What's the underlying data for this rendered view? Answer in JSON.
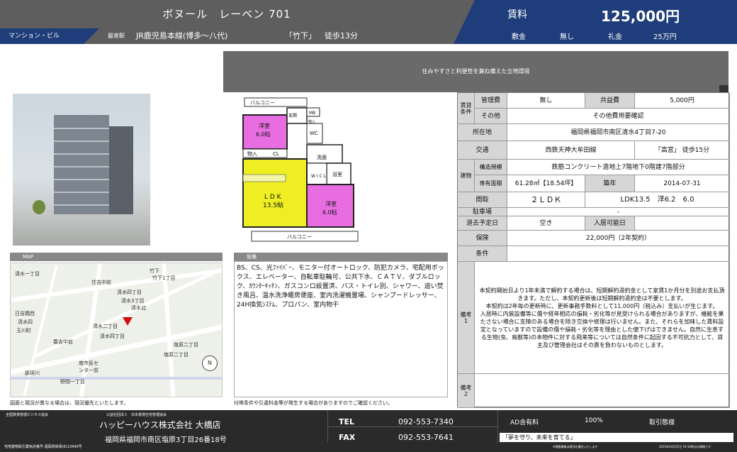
{
  "header": {
    "title": "ボヌール　レーベン 701",
    "category": "マンション・ビル",
    "station_label": "最寄駅",
    "line": "JR鹿児島本線(博多～八代)",
    "station": "「竹下」",
    "walk": "徒歩13分"
  },
  "price": {
    "rent_label": "賃料",
    "rent": "125,000円",
    "deposit_label": "敷金",
    "deposit": "無し",
    "key_label": "礼金",
    "key_money": "25万円"
  },
  "banner": "住みやすさと利便性を兼ね備えた立地環境",
  "floorplan": {
    "balcony_top": "バルコニー",
    "room1": "洋室",
    "room1_size": "6.0帖",
    "entrance": "玄関",
    "mb": "MB",
    "shoebox": "物入",
    "wc": "WC",
    "closet1": "物入",
    "cl": "CL",
    "washroom": "洗面",
    "bath": "浴室",
    "wcl": "W I C L",
    "ldk": "L D K",
    "ldk_size": "13.5帖",
    "room2": "洋室",
    "room2_size": "6.0帖",
    "balcony_bottom": "バルコニー"
  },
  "map": {
    "tab": "MAP",
    "labels": [
      "竹下",
      "清水一丁目",
      "竹下1丁目",
      "住吉中前",
      "清水四丁目",
      "清水3丁目",
      "清水北",
      "日吉橋西",
      "清水四",
      "玉川町",
      "清水二丁目",
      "春吉中前",
      "清水四丁目",
      "塩原二丁目",
      "塩原二丁目",
      "南市民セ",
      "ンター前",
      "那珂川",
      "野間一丁目"
    ],
    "compass": "N",
    "note": "図面と現況が異なる場合は、現況優先といたします。"
  },
  "equipment": {
    "tab": "設備",
    "text": "BS、CS、光ﾌｧｲﾊﾞｰ、モニター付オートロック、防犯カメラ、宅配用ボックス、エレベーター、自転車駐輪可、公共下水、ＣＡＴＶ、ダブルロック、ｶｳﾝﾀｰｷｯﾁﾝ、ガスコンロ設置済、バス・トイレ別、シャワー、追い焚き風呂、温水洗浄暖房便座、室内洗濯機置場、シャンプードレッサー、24H換気ｼｽﾃﾑ、プロパン、室内物干",
    "note": "付帯条件や引違料金等が発生する場合がありますのでご確認ください。"
  },
  "table": {
    "conditions_label": "賃貸条件",
    "mgmt_label": "管理費",
    "mgmt": "無し",
    "common_label": "共益費",
    "common": "5,000円",
    "other_label": "その他",
    "other": "その他費用要確認",
    "address_label": "所在地",
    "address": "福岡県福岡市南区清水4丁目7-20",
    "traffic_label": "交通",
    "traffic_line": "西鉄天神大牟田線",
    "traffic_station": "「高宮」 徒歩15分",
    "building_label": "建物",
    "structure_label": "構造規模",
    "structure": "鉄筋コンクリート造地上7階地下0階建7階部分",
    "area_label": "専有面積",
    "area": "61.28㎡【18.54坪】",
    "built_label": "築年",
    "built": "2014-07-31",
    "layout_label": "間取",
    "layout": "２ＬＤＫ",
    "layout_detail": "LDK13.5　洋6.2　6.0",
    "parking_label": "駐車場",
    "parking": "-",
    "movein_label": "退去予定日",
    "movein": "空き",
    "available_label": "入居可能日",
    "available": "",
    "insurance_label": "保険",
    "insurance": "22,000円（2年契約）",
    "terms_label": "条件",
    "terms": "",
    "remarks1_label": "備考1",
    "remarks1": "本契約開始日より1年未満で解約する場合は、短期解約違約金として家賃1か月分を別途お支払頂きます。ただし、本契約更新後は短期解約違約金は不要とします。\n本契約は2年毎の更新時に、更新事務手数料として11,000円（税込み）支払いが生じます。\n入居時に内装設備等に傷や経年相応の損耗・劣化等が見受けられる場合がありますが、機能を果たさない場合に支障のある場合を除き交換や修理は行いません。また、それらを加味した賃料設定となっていますので設備の傷や損耗・劣化等を理由とした値下げはできません。自然に生息する生物(虫、鳥獣等)の本物件に対する飛来等については自然条件に起因する不可抗力として、貸主及び管理会社はその責を負わないものとします。",
    "remarks2_label": "備考2",
    "remarks2": ""
  },
  "footer": {
    "association1": "全国賃貸管理ビジネス協会",
    "association2": "公益社団法人　日本賃貸住宅管理協会",
    "company": "ハッピーハウス株式会社 大橋店",
    "address": "福岡県福岡市南区塩原3丁目26番18号",
    "license": "宅地建物取引業免許番号 福岡県知事(6)13400号",
    "tel_label": "TEL",
    "tel": "092-553-7340",
    "fax_label": "FAX",
    "fax": "092-553-7641",
    "ad_label": "AD含有料",
    "ad_value": "100%",
    "type": "取引態様",
    "motto": "「夢を守り、未来を育てる」",
    "note": "※掲載情報は現況を優先いたします",
    "updated": "2025年04月25日 19:16時点の情報です"
  },
  "colors": {
    "header_gray": "#5e5e5e",
    "brand_navy": "#1e3d7a",
    "room_pink": "#e86de0",
    "ldk_yellow": "#eeee22",
    "footer_dark": "#2a2a2a"
  }
}
